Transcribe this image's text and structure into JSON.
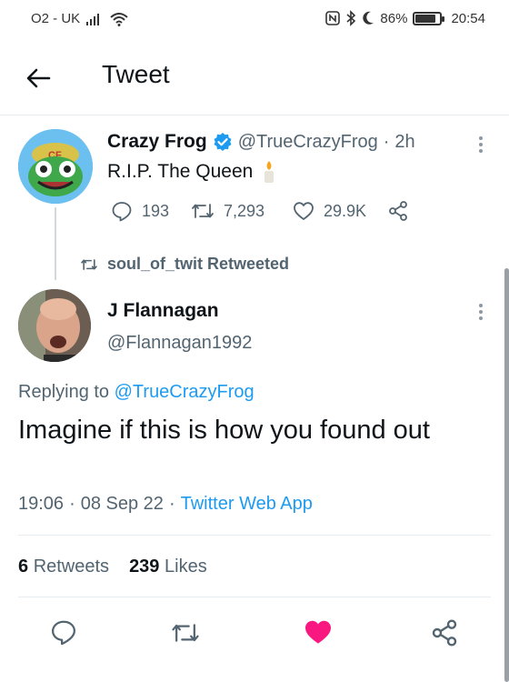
{
  "status_bar": {
    "carrier": "O2 - UK",
    "battery": "86%",
    "time": "20:54",
    "battery_level": 0.86
  },
  "header": {
    "title": "Tweet"
  },
  "parent_tweet": {
    "name": "Crazy Frog",
    "handle": "@TrueCrazyFrog",
    "separator": "·",
    "time": "2h",
    "text": "R.I.P. The Queen",
    "emoji": "🕯",
    "replies": "193",
    "retweets": "7,293",
    "likes": "29.9K",
    "avatar_label": "CF"
  },
  "retweet_context": {
    "text": "soul_of_twit Retweeted"
  },
  "main_tweet": {
    "name": "J Flannagan",
    "handle": "@Flannagan1992",
    "replying_prefix": "Replying to",
    "replying_to": "@TrueCrazyFrog",
    "text": "Imagine if this is how you found out",
    "time": "19:06",
    "date": "08 Sep 22",
    "source": "Twitter Web App",
    "dot": "·"
  },
  "stats": {
    "retweets_count": "6",
    "retweets_label": "Retweets",
    "likes_count": "239",
    "likes_label": "Likes"
  },
  "colors": {
    "link": "#1d9bf0",
    "like_active": "#f91880",
    "verified": "#1d9bf0",
    "secondary": "#536471"
  },
  "icons": {
    "back": "arrow-left-icon",
    "verified": "verified-badge-icon",
    "more": "more-vertical-icon",
    "reply": "reply-icon",
    "retweet": "retweet-icon",
    "like": "heart-icon",
    "share": "share-icon"
  }
}
